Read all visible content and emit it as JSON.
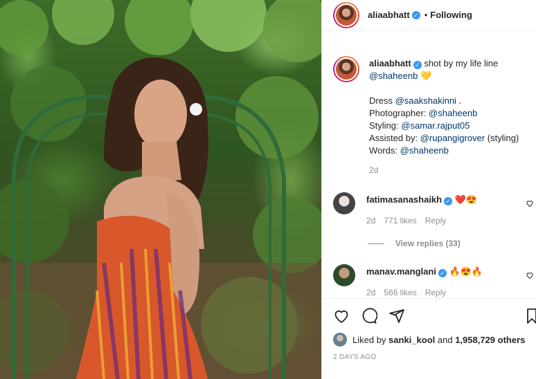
{
  "header": {
    "username": "aliaabhatt",
    "separator": "•",
    "follow_status": "Following"
  },
  "caption": {
    "username": "aliaabhatt",
    "text_main": "shot by my life line",
    "mention": "@shaheenb",
    "emoji": "💛",
    "lines": [
      {
        "label": "Dress",
        "mention": "@saakshakinni",
        "suffix": " ."
      },
      {
        "label": "Photographer:",
        "mention": "@shaheenb",
        "suffix": ""
      },
      {
        "label": "Styling:",
        "mention": "@samar.rajput05",
        "suffix": ""
      },
      {
        "label": "Assisted by:",
        "mention": "@rupangigrover",
        "suffix": " (styling)"
      },
      {
        "label": "Words:",
        "mention": "@shaheenb",
        "suffix": ""
      }
    ],
    "time": "2d"
  },
  "comments": [
    {
      "username": "fatimasanashaikh",
      "text": "❤️😍",
      "time": "2d",
      "likes": "771 likes",
      "reply": "Reply"
    },
    {
      "username": "manav.manglani",
      "text": "🔥😍🔥",
      "time": "2d",
      "likes": "566 likes",
      "reply": "Reply"
    }
  ],
  "view_replies": "View replies (33)",
  "likes": {
    "prefix": "Liked by",
    "user": "sanki_kool",
    "connector": "and",
    "count": "1,958,729 others"
  },
  "timestamp": "2 DAYS AGO",
  "icons": [
    "heart-icon",
    "comment-icon",
    "share-icon",
    "bookmark-icon",
    "verified-icon"
  ],
  "colors": {
    "verified": "#3897f0",
    "link": "#00376b",
    "muted": "#8e8e8e"
  }
}
